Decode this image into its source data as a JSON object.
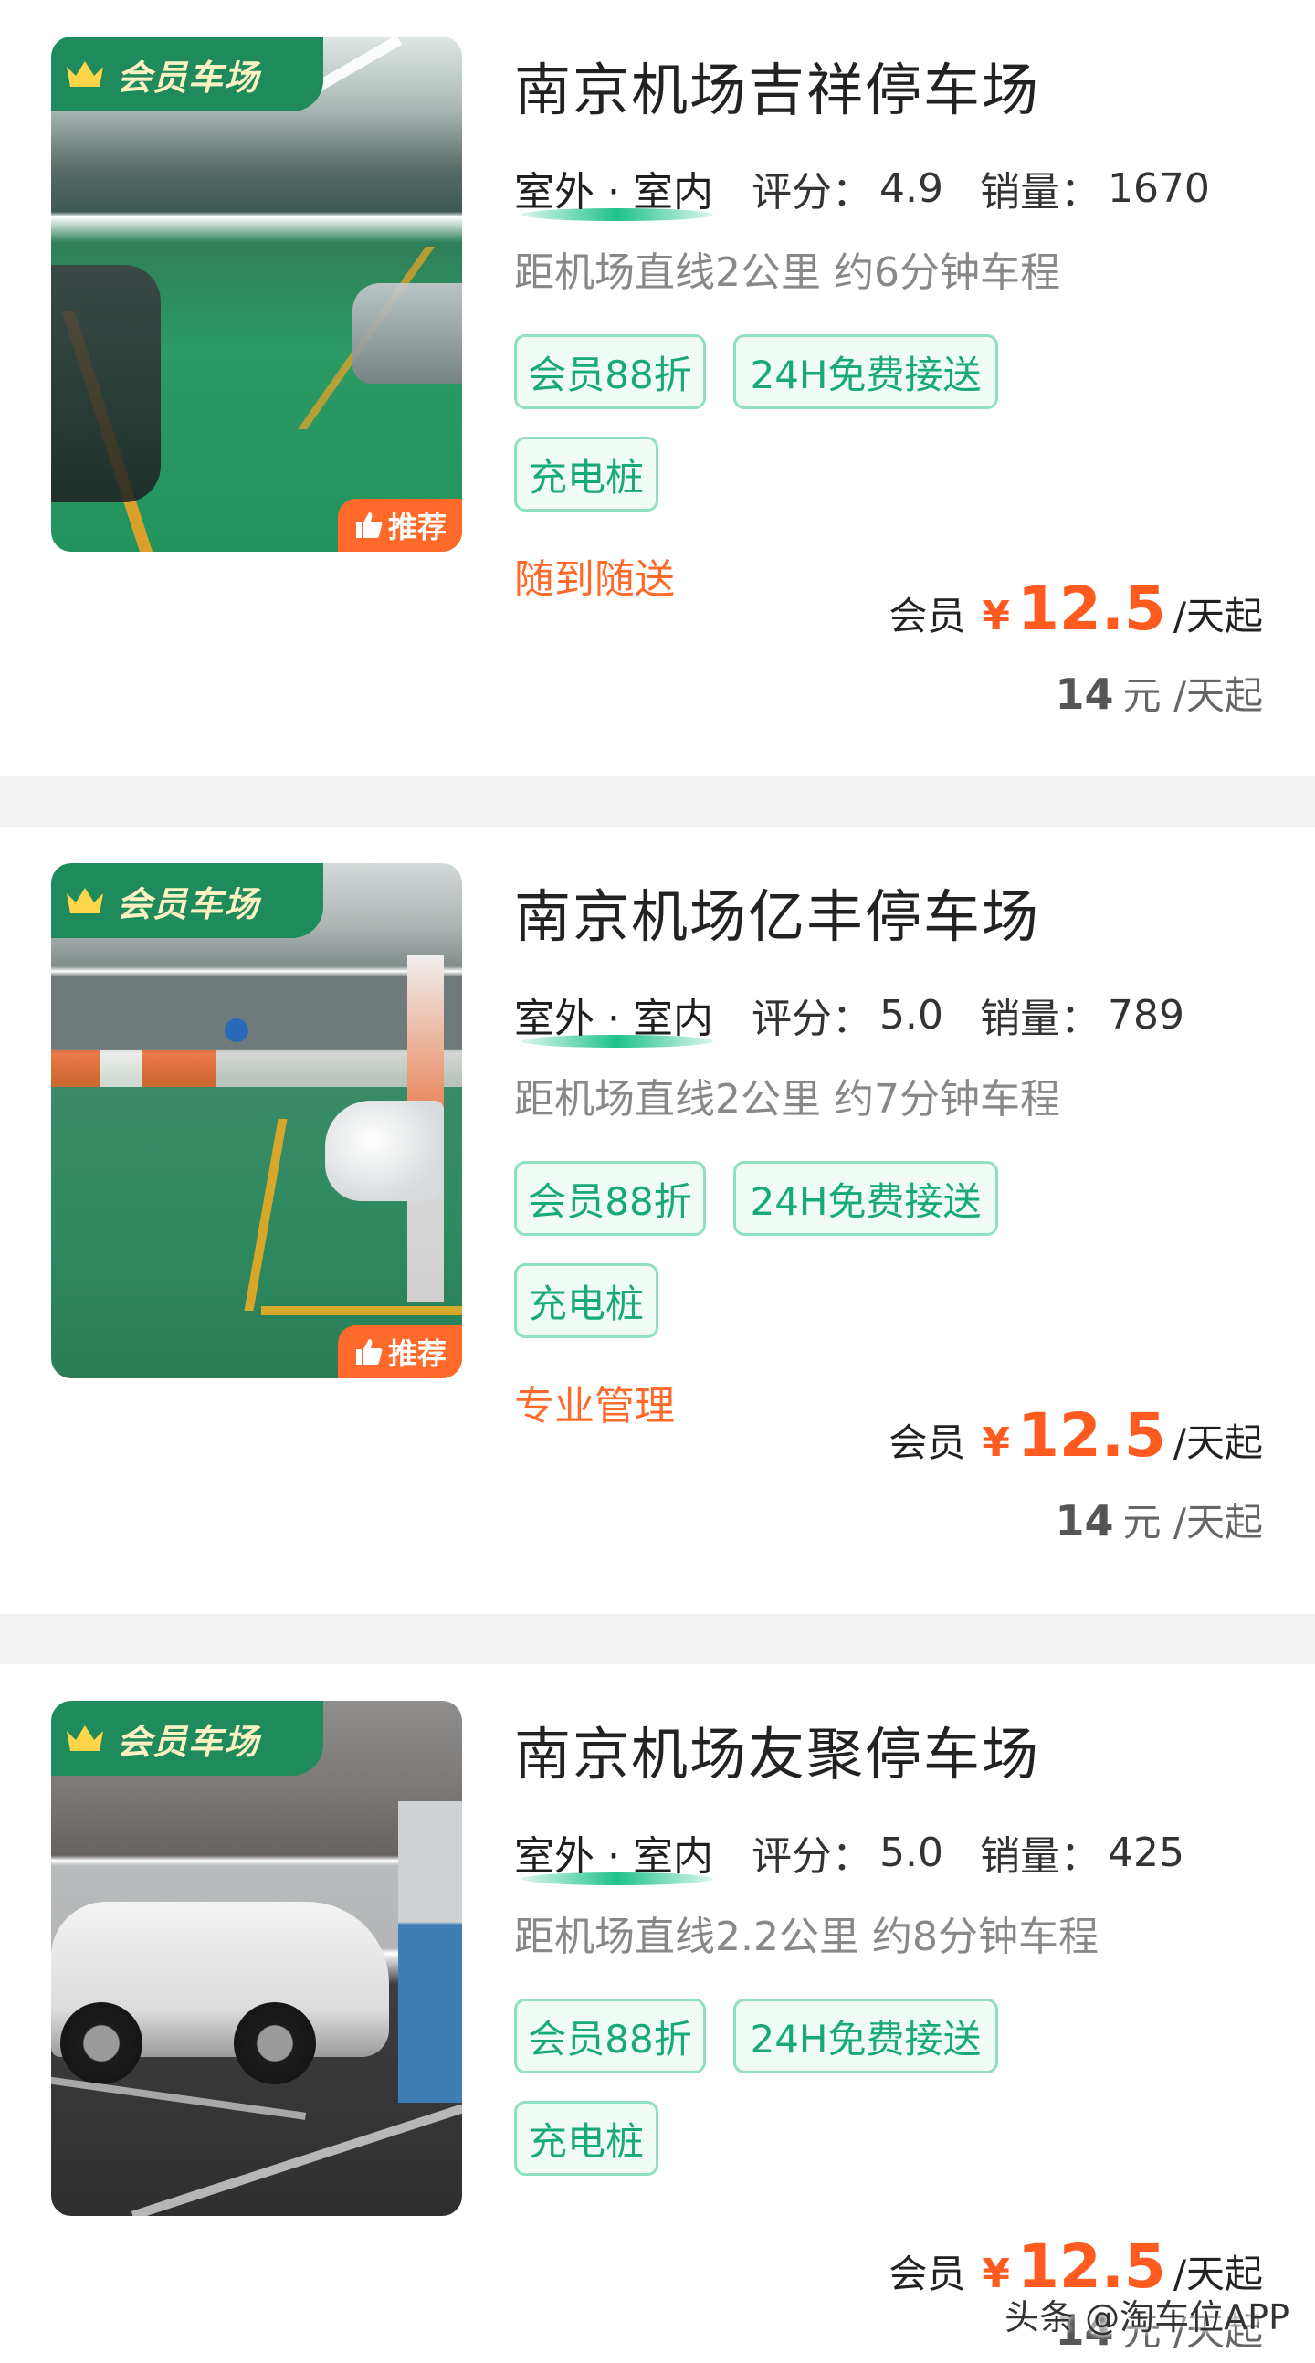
{
  "badges": {
    "member": "会员车场",
    "recommend": "推荐"
  },
  "lots": [
    {
      "name": "南京机场吉祥停车场",
      "environment": "室外 · 室内",
      "score_label": "评分：",
      "score": "4.9",
      "sales_label": "销量：",
      "sales": "1670",
      "distance": "距机场直线2公里 约6分钟车程",
      "tags": [
        "会员88折",
        "24H免费接送",
        "充电桩"
      ],
      "feature": "随到随送",
      "recommended": true,
      "price": {
        "member_label": "会员",
        "currency": "¥",
        "value": "12.5",
        "unit": "/天起"
      },
      "original_price": {
        "value": "14",
        "unit": "元 /天起"
      }
    },
    {
      "name": "南京机场亿丰停车场",
      "environment": "室外 · 室内",
      "score_label": "评分：",
      "score": "5.0",
      "sales_label": "销量：",
      "sales": "789",
      "distance": "距机场直线2公里 约7分钟车程",
      "tags": [
        "会员88折",
        "24H免费接送",
        "充电桩"
      ],
      "feature": "专业管理",
      "recommended": true,
      "price": {
        "member_label": "会员",
        "currency": "¥",
        "value": "12.5",
        "unit": "/天起"
      },
      "original_price": {
        "value": "14",
        "unit": "元 /天起"
      }
    },
    {
      "name": "南京机场友聚停车场",
      "environment": "室外 · 室内",
      "score_label": "评分：",
      "score": "5.0",
      "sales_label": "销量：",
      "sales": "425",
      "distance": "距机场直线2.2公里 约8分钟车程",
      "tags": [
        "会员88折",
        "24H免费接送",
        "充电桩"
      ],
      "feature": "",
      "recommended": false,
      "price": {
        "member_label": "会员",
        "currency": "¥",
        "value": "12.5",
        "unit": "/天起"
      },
      "original_price": {
        "value": "14",
        "unit": "元 /天起"
      }
    }
  ],
  "watermark": "头条 @淘车位APP",
  "icons": {
    "crown": "crown-icon",
    "thumb": "thumbs-up-icon"
  },
  "colors": {
    "brand_green": "#1f8a5b",
    "tag_green": "#17a97a",
    "accent_orange": "#ff5a1f",
    "divider": "#f1f1f1"
  }
}
